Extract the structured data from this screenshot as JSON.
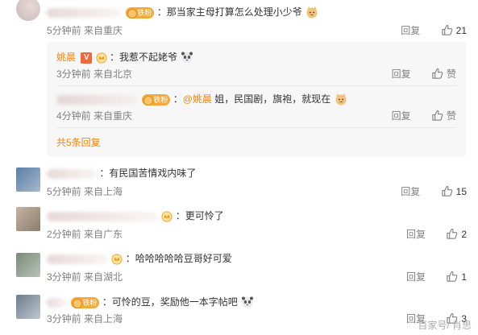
{
  "comments": [
    {
      "text": "：那当家主母打算怎么处理小少爷",
      "badge": "铁粉",
      "time": "5分钟前",
      "location": "来自重庆",
      "reply": "回复",
      "likes": "21"
    },
    {
      "text": "：有民国苦情戏内味了",
      "time": "5分钟前",
      "location": "来自上海",
      "reply": "回复",
      "likes": "15"
    },
    {
      "text": "：更可怜了",
      "time": "2分钟前",
      "location": "来自广东",
      "reply": "回复",
      "likes": "2"
    },
    {
      "text": "：哈哈哈哈哈豆哥好可爱",
      "time": "3分钟前",
      "location": "来自湖北",
      "reply": "回复",
      "likes": "1"
    },
    {
      "text": "：可怜的豆，奖励他一本字帖吧",
      "badge": "铁粉",
      "time": "3分钟前",
      "location": "来自上海",
      "reply": "回复",
      "likes": "3"
    }
  ],
  "replies": [
    {
      "name": "姚晨",
      "v_badge": "V",
      "text": "：我惹不起姥爷",
      "time": "3分钟前",
      "location": "来自北京",
      "reply": "回复",
      "like_label": "赞"
    },
    {
      "badge": "铁粉",
      "mention": "@姚晨",
      "text": " 姐，民国剧，旗袍，就现在",
      "time": "4分钟前",
      "location": "来自重庆",
      "reply": "回复",
      "like_label": "赞"
    }
  ],
  "more_replies": "共5条回复",
  "watermark": "百家号/ 肖思",
  "colors": {
    "accent": "#ff8200",
    "meta": "#808080",
    "subbox": "#f7f7f7"
  }
}
